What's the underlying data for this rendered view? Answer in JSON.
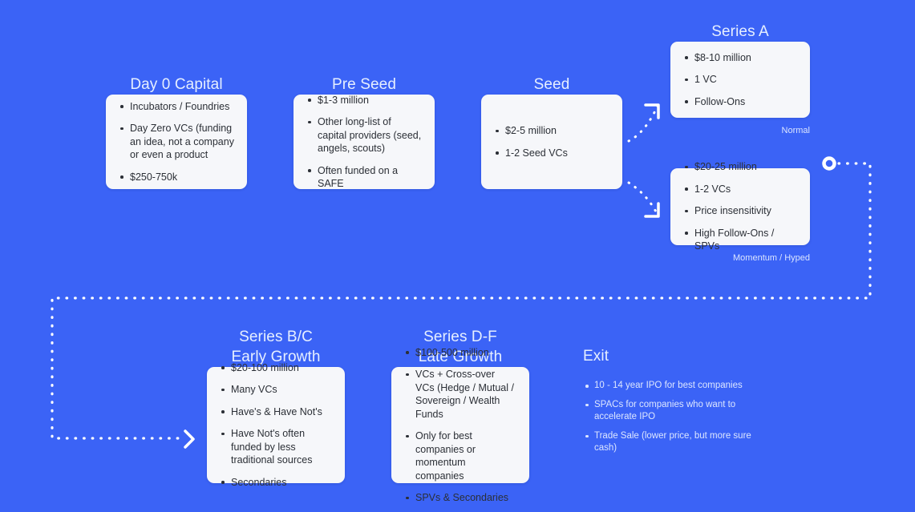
{
  "theme": {
    "background": "#3b63f6",
    "card_background": "#f6f7fa",
    "heading_color": "#e6efff",
    "body_text_color": "#2b2f36",
    "caption_color": "#dbe5ff",
    "connector_color": "#ffffff"
  },
  "stages": {
    "day0": {
      "heading": "Day 0 Capital",
      "bullets": [
        "Incubators / Foundries",
        "Day Zero VCs (funding an idea, not a company or even a product",
        "$250-750k"
      ]
    },
    "pre_seed": {
      "heading": "Pre Seed",
      "bullets": [
        "$1-3 million",
        "Other long-list of capital providers (seed, angels, scouts)",
        "Often funded on a SAFE"
      ]
    },
    "seed": {
      "heading": "Seed",
      "bullets": [
        "$2-5 million",
        "1-2 Seed VCs"
      ]
    },
    "series_a": {
      "heading": "Series A",
      "bullets": [
        "$8-10 million",
        "1 VC",
        "Follow-Ons"
      ],
      "caption": "Normal"
    },
    "momentum": {
      "bullets": [
        "$20-25 million",
        "1-2 VCs",
        "Price insensitivity",
        "High Follow-Ons / SPVs"
      ],
      "caption": "Momentum / Hyped"
    },
    "series_bc": {
      "heading": "Series B/C\nEarly Growth",
      "bullets": [
        "$20-100 million",
        "Many VCs",
        "Have's & Have Not's",
        "Have Not's often funded by less traditional sources",
        "Secondaries"
      ]
    },
    "series_df": {
      "heading": "Series D-F\nLate Growth",
      "bullets": [
        "$100-500 million",
        "VCs + Cross-over VCs (Hedge / Mutual / Sovereign / Wealth Funds",
        "Only for best companies or momentum companies",
        "SPVs & Secondaries"
      ]
    },
    "exit": {
      "heading": "Exit",
      "bullets": [
        "10 - 14 year IPO for best companies",
        "SPACs for companies who want to accelerate IPO",
        "Trade Sale (lower price, but more sure cash)"
      ]
    }
  }
}
